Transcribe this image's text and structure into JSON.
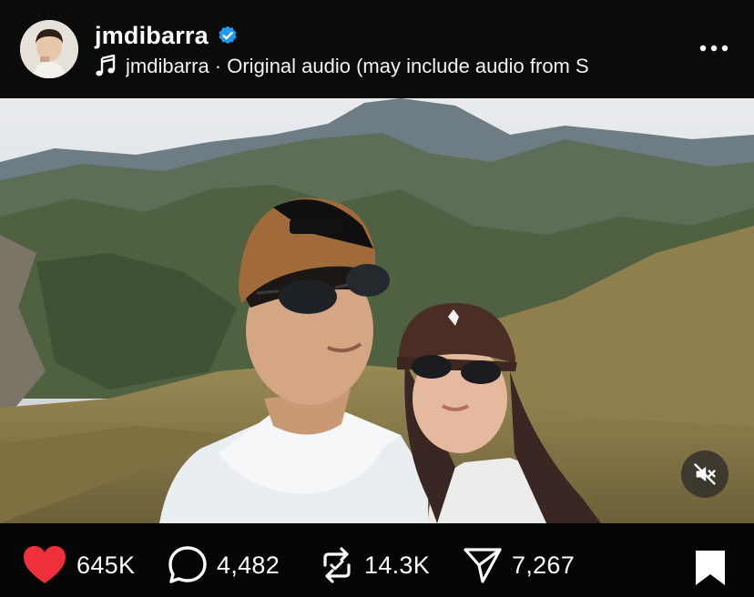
{
  "post": {
    "username": "jmdibarra",
    "verified": true,
    "audio_text": "jmdibarra · Original audio  (may include audio from S",
    "icons": {
      "avatar": "avatar",
      "verified": "verified-badge-icon",
      "music": "music-note-icon",
      "more": "more-options-icon",
      "mute": "speaker-muted-icon"
    }
  },
  "actions": {
    "likes": "645K",
    "comments": "4,482",
    "reposts": "14.3K",
    "shares": "7,267",
    "icons": {
      "like": "heart-filled-icon",
      "comment": "comment-bubble-icon",
      "repost": "repost-icon",
      "share": "send-icon",
      "save": "bookmark-filled-icon"
    }
  },
  "colors": {
    "like_active": "#ee2f3c",
    "verified_blue": "#1d9bf0",
    "background": "#000000"
  }
}
